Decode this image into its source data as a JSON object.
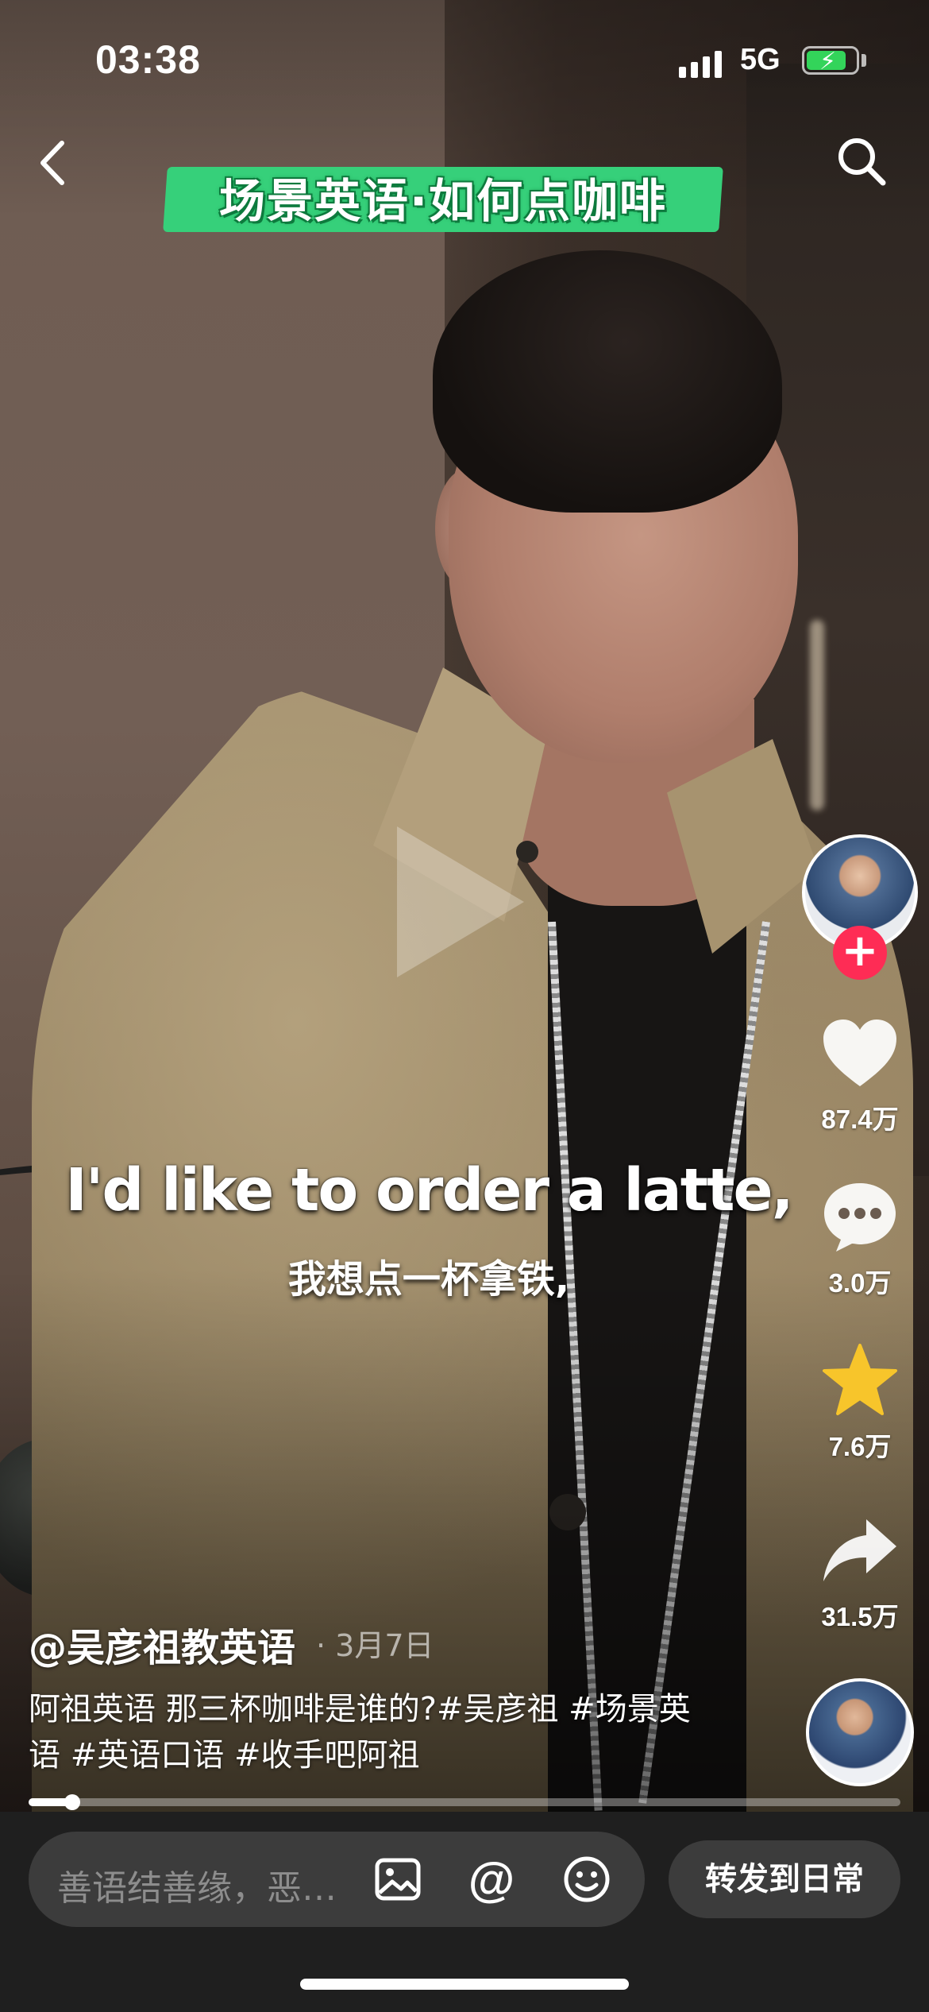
{
  "status_bar": {
    "time": "03:38",
    "network": "5G",
    "battery_level": 0.9
  },
  "video": {
    "banner_title": "场景英语·如何点咖啡",
    "subtitle_en": "I'd like to order a latte,",
    "subtitle_zh": "我想点一杯拿铁,",
    "progress": 0.05
  },
  "rail": {
    "follow_symbol": "+",
    "likes": "87.4万",
    "comments": "3.0万",
    "favorites": "7.6万",
    "shares": "31.5万"
  },
  "post": {
    "author": "@吴彦祖教英语",
    "date": "· 3月7日",
    "caption": "阿祖英语 那三杯咖啡是谁的?#吴彦祖 #场景英语 #英语口语 #收手吧阿祖"
  },
  "bottom_bar": {
    "comment_placeholder": "善语结善缘，恶…",
    "forward_label": "转发到日常"
  },
  "colors": {
    "banner": "#36d07a",
    "follow": "#fe2c55",
    "star": "#f7c52b"
  }
}
